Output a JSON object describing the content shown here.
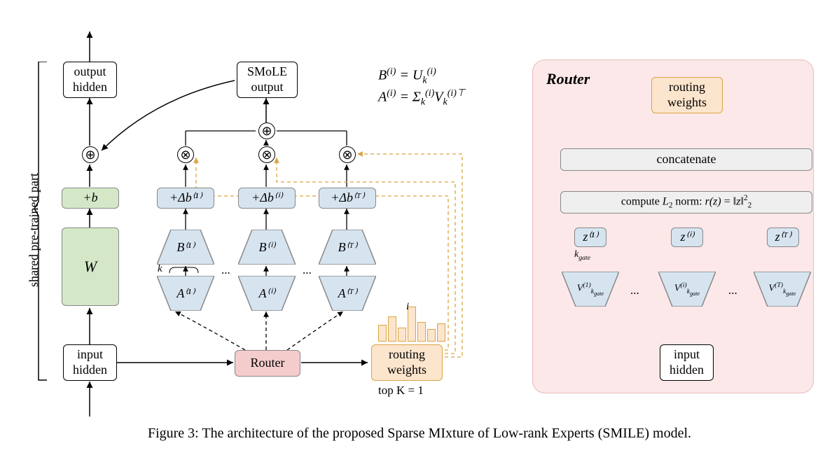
{
  "left": {
    "output_hidden": "output\nhidden",
    "input_hidden": "input\nhidden",
    "W": "W",
    "bias": "+b",
    "vertical_label": "shared pre-trained part",
    "smole_output": "SMoLE\noutput",
    "router": "Router",
    "routing_weights": "routing\nweights",
    "topk": "top K = 1",
    "k_label": "k",
    "bar_label": "i",
    "experts": [
      {
        "A": "A⁽¹⁾",
        "B": "B⁽¹⁾",
        "db": "+Δb⁽¹⁾"
      },
      {
        "A": "A⁽ⁱ⁾",
        "B": "B⁽ⁱ⁾",
        "db": "+Δb⁽ⁱ⁾"
      },
      {
        "A": "A⁽ᵀ⁾",
        "B": "B⁽ᵀ⁾",
        "db": "+Δb⁽ᵀ⁾"
      }
    ],
    "dots": "..."
  },
  "equations": {
    "line1": "B⁽ⁱ⁾ = Uₖ⁽ⁱ⁾",
    "line2": "A⁽ⁱ⁾ = Σₖ⁽ⁱ⁾Vₖ⁽ⁱ⁾ᵀ"
  },
  "right": {
    "title": "Router",
    "routing_weights": "routing\nweights",
    "concatenate": "concatenate",
    "compute_norm": "compute L₂ norm: r(z) = ‖z‖²₂",
    "input_hidden": "input\nhidden",
    "kgate_label": "k_gate",
    "z": [
      "z⁽¹⁾",
      "z⁽ⁱ⁾",
      "z⁽ᵀ⁾"
    ],
    "V": [
      "V⁽¹⁾_k_gate",
      "V⁽ⁱ⁾_k_gate",
      "V⁽ᵀ⁾_k_gate"
    ],
    "dots": "..."
  },
  "caption": "Figure 3: The architecture of the proposed Sparse MIxture of Low-rank Experts (SMILE) model."
}
